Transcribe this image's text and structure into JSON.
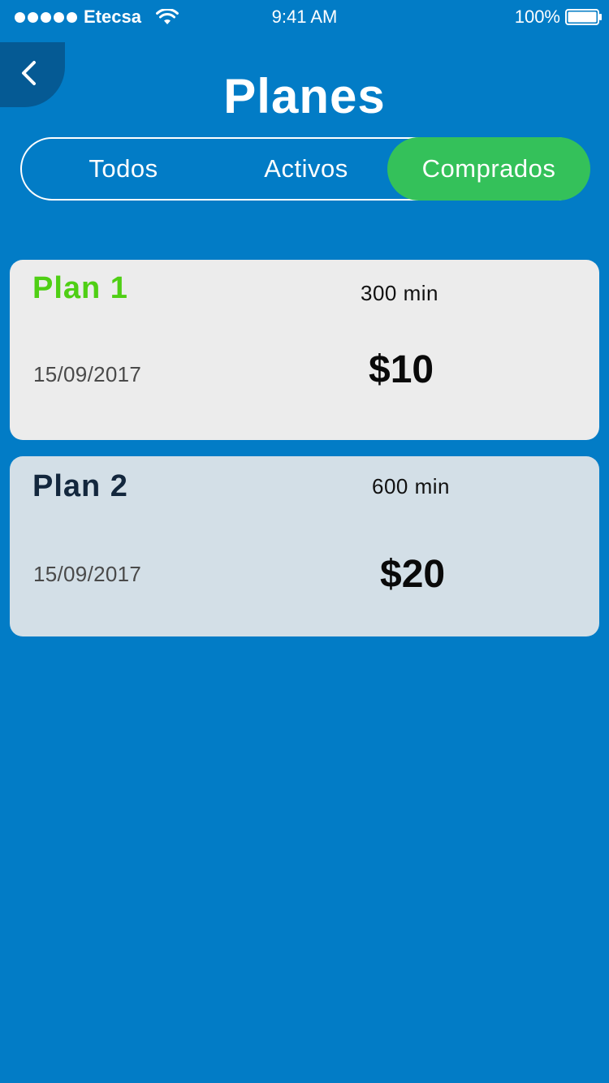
{
  "status_bar": {
    "carrier": "Etecsa",
    "time": "9:41 AM",
    "battery": "100%"
  },
  "header": {
    "title": "Planes"
  },
  "tabs": [
    {
      "label": "Todos",
      "selected": false
    },
    {
      "label": "Activos",
      "selected": false
    },
    {
      "label": "Comprados",
      "selected": true
    }
  ],
  "plans": [
    {
      "name": "Plan 1",
      "minutes": "300 min",
      "date": "15/09/2017",
      "price": "$10"
    },
    {
      "name": "Plan 2",
      "minutes": "600 min",
      "date": "15/09/2017",
      "price": "$20"
    }
  ],
  "colors": {
    "background": "#027cc6",
    "back_button": "#055a94",
    "selected_tab": "#34c15a",
    "plan1_name": "#4fcf14",
    "card1_bg": "#ececec",
    "card2_bg": "#d3dfe7"
  }
}
